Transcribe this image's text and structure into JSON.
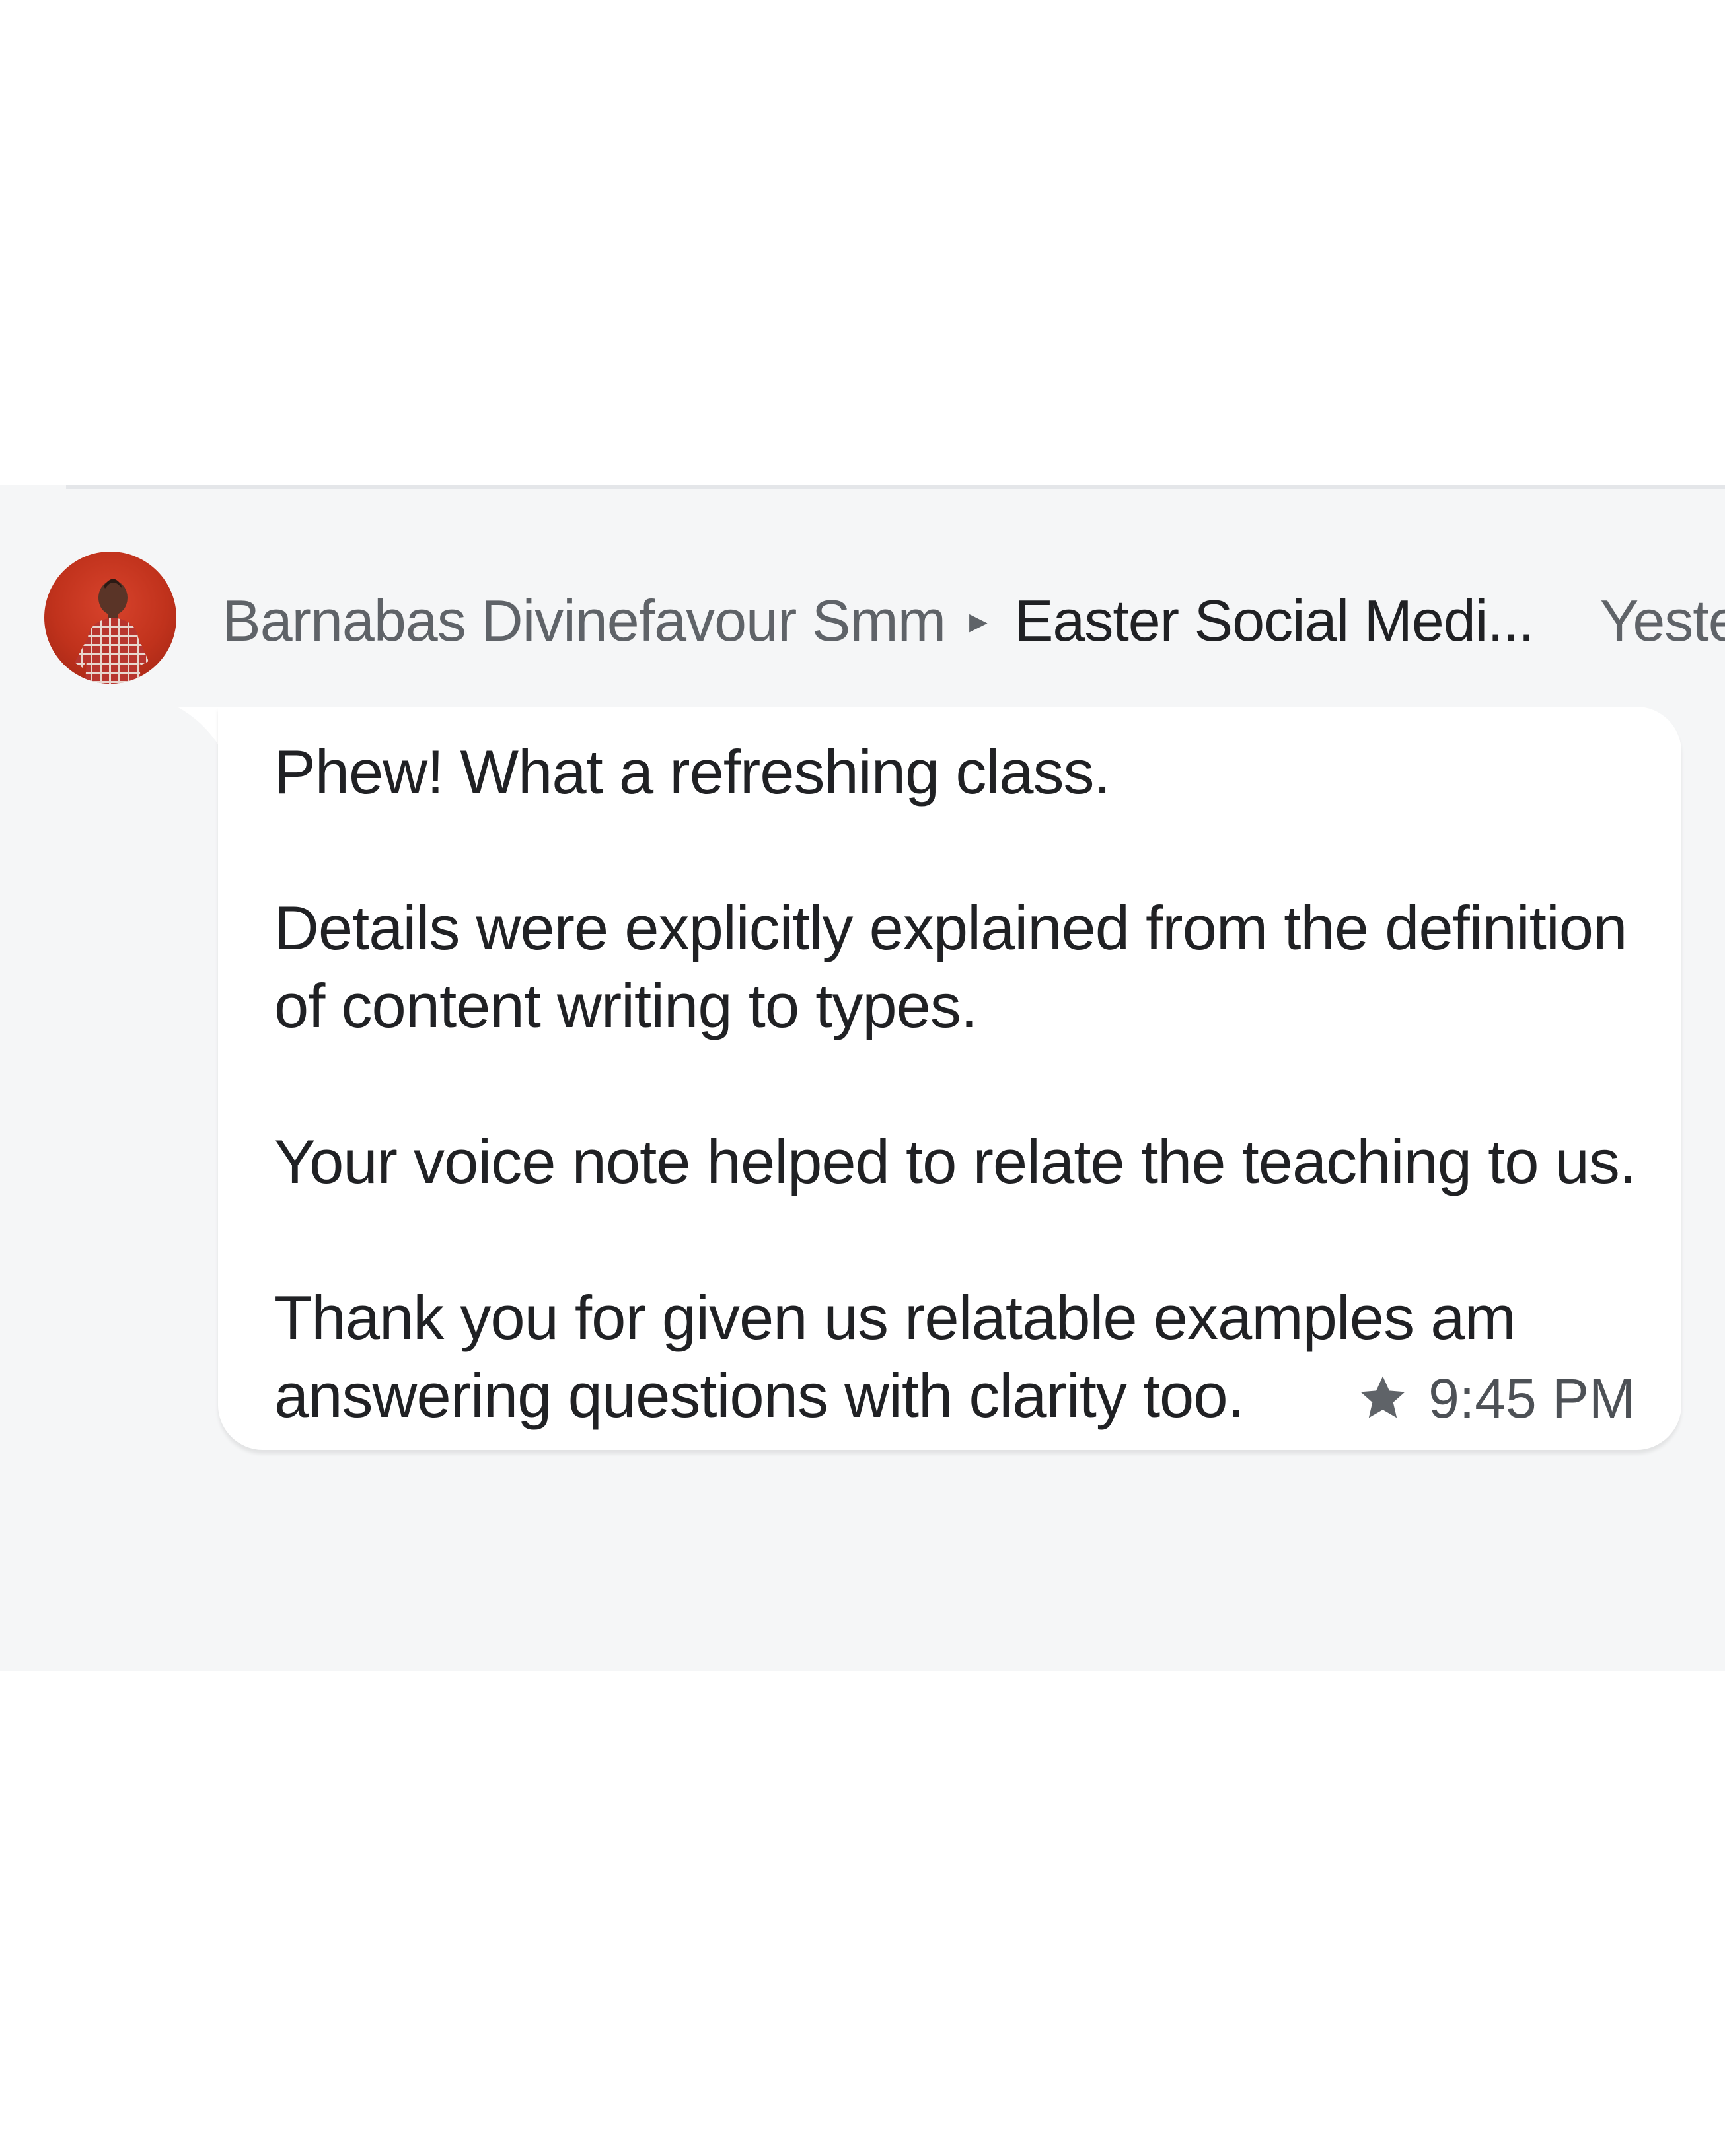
{
  "message_card": {
    "sender_name": "Barnabas Divinefavour Smm",
    "channel_name": "Easter Social Medi...",
    "header_time": "Yeste",
    "paragraphs": [
      "Phew! What a refreshing class.",
      "Details were explicitly explained from the definition of content writing to types.",
      "Your voice note helped to relate the teaching to us.",
      "Thank you for given us relatable examples am answering questions with clarity too."
    ],
    "time": "9:45 PM",
    "icons": {
      "avatar": "person-photo",
      "separator": "right-triangle-icon",
      "starred": "star-icon"
    },
    "colors": {
      "avatar_bg": "#c0321c",
      "panel_bg": "#f5f6f7",
      "bubble_bg": "#ffffff",
      "secondary_text": "#5f6368",
      "primary_text": "#202124"
    }
  }
}
